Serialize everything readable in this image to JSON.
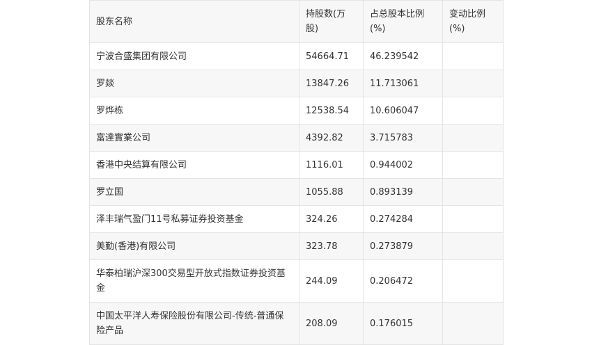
{
  "table": {
    "headers": [
      "股东名称",
      "持股数(万股)",
      "占总股本比例(%)",
      "变动比例(%)"
    ],
    "rows": [
      [
        "宁波合盛集团有限公司",
        "54664.71",
        "46.239542",
        ""
      ],
      [
        "罗燚",
        "13847.26",
        "11.713061",
        ""
      ],
      [
        "罗烨栋",
        "12538.54",
        "10.606047",
        ""
      ],
      [
        "富達實業公司",
        "4392.82",
        "3.715783",
        ""
      ],
      [
        "香港中央结算有限公司",
        "1116.01",
        "0.944002",
        ""
      ],
      [
        "罗立国",
        "1055.88",
        "0.893139",
        ""
      ],
      [
        "泽丰瑞气盈门11号私募证券投资基金",
        "324.26",
        "0.274284",
        ""
      ],
      [
        "美勤(香港)有限公司",
        "323.78",
        "0.273879",
        ""
      ],
      [
        "华泰柏瑞沪深300交易型开放式指数证券投资基金",
        "244.09",
        "0.206472",
        ""
      ],
      [
        "中国太平洋人寿保险股份有限公司-传统-普通保险产品",
        "208.09",
        "0.176015",
        ""
      ]
    ]
  }
}
